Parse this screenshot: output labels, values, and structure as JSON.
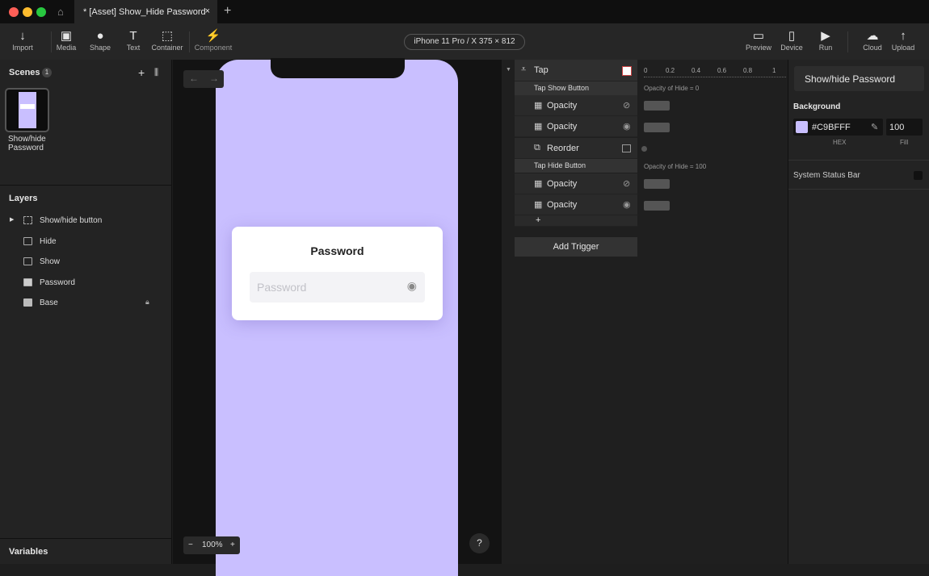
{
  "window": {
    "tab_title": "* [Asset] Show_Hide Password",
    "close": "×",
    "new_tab": "+"
  },
  "toolbar": {
    "tools": [
      {
        "icon": "↓",
        "label": "Import"
      },
      {
        "icon": "▣",
        "label": "Media"
      },
      {
        "icon": "●",
        "label": "Shape"
      },
      {
        "icon": "T",
        "label": "Text"
      },
      {
        "icon": "⬚",
        "label": "Container"
      },
      {
        "icon": "⚡",
        "label": "Component"
      }
    ],
    "device": "iPhone 11 Pro / X  375 × 812",
    "right_tools": [
      {
        "icon": "▭",
        "label": "Preview"
      },
      {
        "icon": "▯",
        "label": "Device"
      },
      {
        "icon": "▶",
        "label": "Run"
      },
      {
        "icon": "☁",
        "label": "Cloud"
      },
      {
        "icon": "↑",
        "label": "Upload"
      }
    ]
  },
  "scenes": {
    "title": "Scenes",
    "count": "1",
    "add": "+",
    "items": [
      {
        "label": "Show/hide Password"
      }
    ]
  },
  "layers": {
    "title": "Layers",
    "items": [
      {
        "label": "Show/hide button"
      },
      {
        "label": "Hide"
      },
      {
        "label": "Show"
      },
      {
        "label": "Password"
      },
      {
        "label": "Base"
      }
    ]
  },
  "variables": {
    "title": "Variables"
  },
  "canvas": {
    "zoom": "100%",
    "zoom_out": "−",
    "zoom_in": "+",
    "help": "?",
    "nav_back": "←",
    "nav_fwd": "→",
    "card": {
      "title": "Password",
      "placeholder": "Password"
    }
  },
  "interactions": {
    "trigger": "Tap",
    "timeline_ticks": [
      "0",
      "0.2",
      "0.4",
      "0.6",
      "0.8",
      "1"
    ],
    "groups": [
      {
        "label": "Tap Show Button",
        "note": "Opacity of Hide = 0",
        "rows": [
          {
            "label": "Opacity",
            "icon": "eye-slash"
          },
          {
            "label": "Opacity",
            "icon": "eye"
          },
          {
            "label": "Reorder",
            "icon": "layer"
          }
        ]
      },
      {
        "label": "Tap Hide Button",
        "note": "Opacity of Hide = 100",
        "rows": [
          {
            "label": "Opacity",
            "icon": "eye-slash"
          },
          {
            "label": "Opacity",
            "icon": "eye"
          }
        ]
      }
    ],
    "add": "+",
    "add_trigger": "Add Trigger"
  },
  "properties": {
    "scene_name": "Show/hide Password",
    "background_label": "Background",
    "hex": "#C9BFFF",
    "fill": "100",
    "hex_label": "HEX",
    "fill_label": "Fill",
    "status_bar": "System Status Bar"
  }
}
